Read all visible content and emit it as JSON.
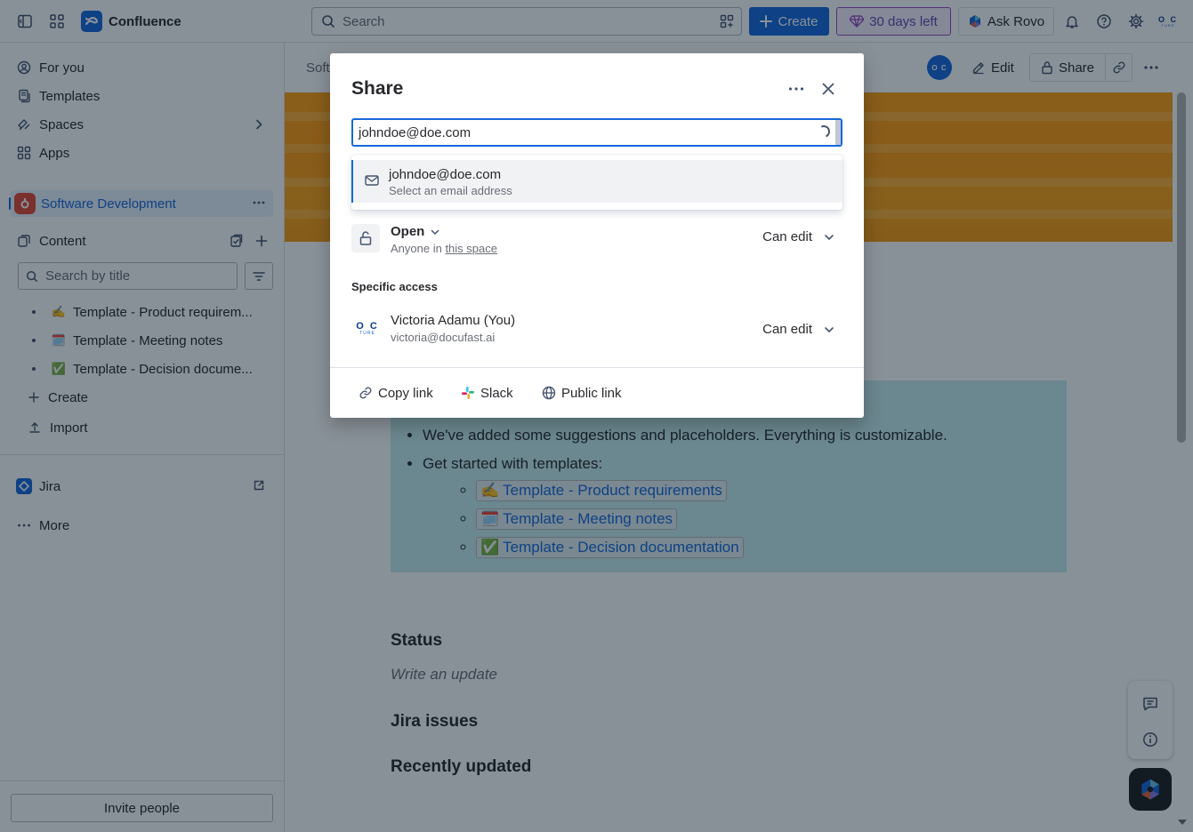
{
  "app": {
    "name": "Confluence"
  },
  "topbar": {
    "search_placeholder": "Search",
    "create_label": "Create",
    "trial_label": "30 days left",
    "rovo_label": "Ask Rovo",
    "avatar_top": "O C",
    "avatar_bottom": "TURE"
  },
  "sidebar": {
    "nav": [
      {
        "label": "For you",
        "icon": "user-circle-icon"
      },
      {
        "label": "Templates",
        "icon": "templates-icon"
      },
      {
        "label": "Spaces",
        "icon": "spaces-icon"
      },
      {
        "label": "Apps",
        "icon": "apps-icon"
      }
    ],
    "space_name": "Software Development",
    "content_label": "Content",
    "title_search_placeholder": "Search by title",
    "tree": [
      {
        "emoji": "✍️",
        "label": "Template - Product requirem..."
      },
      {
        "emoji": "🗓️",
        "label": "Template - Meeting notes"
      },
      {
        "emoji": "✅",
        "label": "Template - Decision docume..."
      }
    ],
    "create_label": "Create",
    "import_label": "Import",
    "jira_label": "Jira",
    "more_label": "More",
    "invite_label": "Invite people"
  },
  "page": {
    "breadcrumb": "Soft",
    "avatar_text": "O C",
    "edit_label": "Edit",
    "share_label": "Share",
    "bullet_1": "We've added some suggestions and placeholders. Everything is customizable.",
    "bullet_2": "Get started with templates:",
    "template_links": [
      {
        "emoji": "✍️",
        "label": "Template - Product requirements"
      },
      {
        "emoji": "🗓️",
        "label": "Template - Meeting notes"
      },
      {
        "emoji": "✅",
        "label": "Template - Decision documentation"
      }
    ],
    "status_heading": "Status",
    "status_placeholder": "Write an update",
    "jira_heading": "Jira issues",
    "recent_heading": "Recently updated"
  },
  "share_modal": {
    "title": "Share",
    "input_value": "johndoe@doe.com",
    "suggestion_email": "johndoe@doe.com",
    "suggestion_hint": "Select an email address",
    "general_access_title": "Open",
    "general_access_prefix": "Anyone in ",
    "general_access_link": "this space",
    "general_access_permission": "Can edit",
    "specific_access_heading": "Specific access",
    "user_name": "Victoria Adamu (You)",
    "user_email": "victoria@docufast.ai",
    "user_permission": "Can edit",
    "copy_link_label": "Copy link",
    "slack_label": "Slack",
    "public_link_label": "Public link"
  },
  "colors": {
    "brand_blue": "#1868db",
    "banner_orange": "#ff9f12",
    "panel_teal": "#c6edee",
    "overlay": "rgba(5,21,36,0.47)"
  }
}
